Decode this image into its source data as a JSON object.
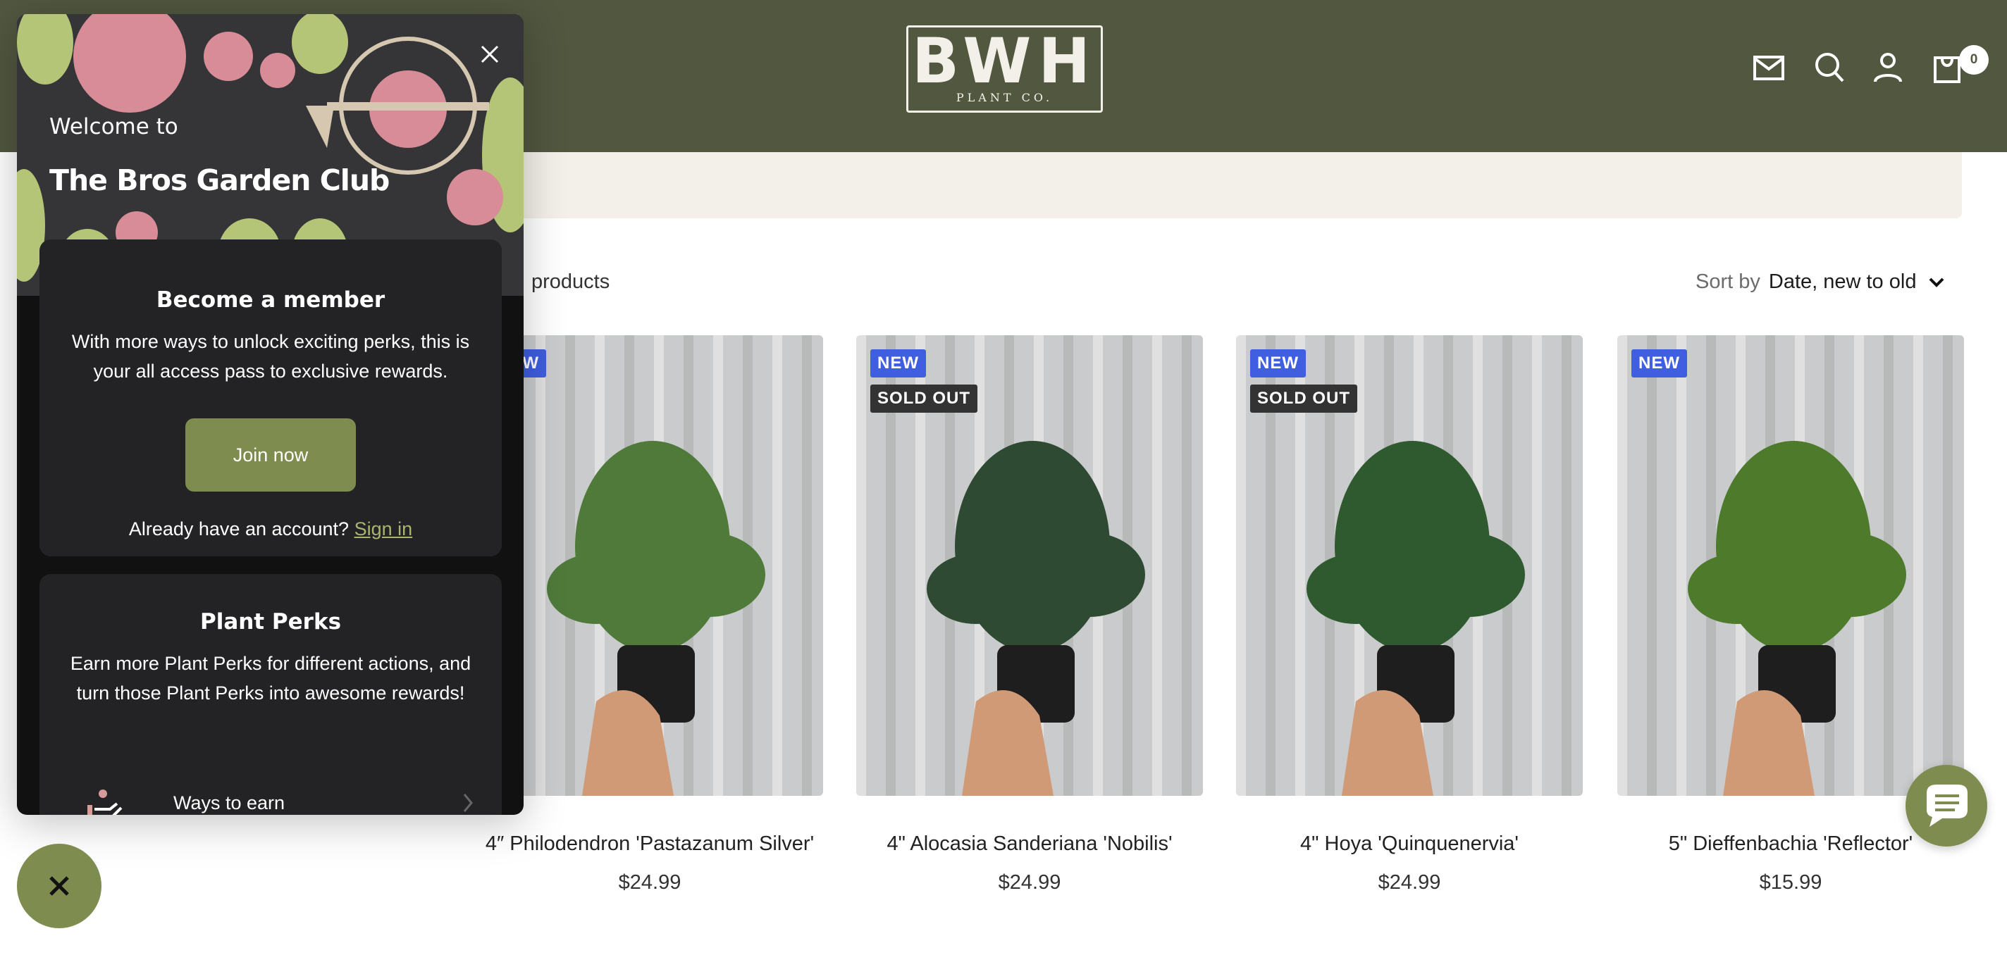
{
  "header": {
    "logo_main": "BWH",
    "logo_sub": "PLANT CO.",
    "icons": [
      "mail-icon",
      "search-icon",
      "account-icon",
      "cart-icon"
    ],
    "cart_count": "0",
    "bg_color": "#525740"
  },
  "collection": {
    "count_text": "products",
    "sort_label": "Sort by",
    "sort_value": "Date, new to old"
  },
  "products": [
    {
      "title": "4″ Philodendron 'Pastazanum Silver'",
      "price": "$24.99",
      "badges": [
        "NEW"
      ]
    },
    {
      "title": "4\" Alocasia Sanderiana 'Nobilis'",
      "price": "$24.99",
      "badges": [
        "NEW",
        "SOLD OUT"
      ]
    },
    {
      "title": "4\" Hoya 'Quinquenervia'",
      "price": "$24.99",
      "badges": [
        "NEW",
        "SOLD OUT"
      ]
    },
    {
      "title": "5\" Dieffenbachia 'Reflector'",
      "price": "$15.99",
      "badges": [
        "NEW"
      ]
    }
  ],
  "popup": {
    "welcome": "Welcome to",
    "title": "The Bros Garden Club",
    "logo_text": "THE BROS GARDEN CLUB",
    "member": {
      "heading": "Become a member",
      "body": "With more ways to unlock exciting perks, this is your all access pass to exclusive rewards.",
      "join": "Join now",
      "account_prompt": "Already have an account?",
      "sign_in": "Sign in"
    },
    "perks": {
      "heading": "Plant Perks",
      "body": "Earn more Plant Perks for different actions, and turn those Plant Perks into awesome rewards!",
      "ways_to_earn": "Ways to earn"
    },
    "accent": "#7f8c50"
  }
}
